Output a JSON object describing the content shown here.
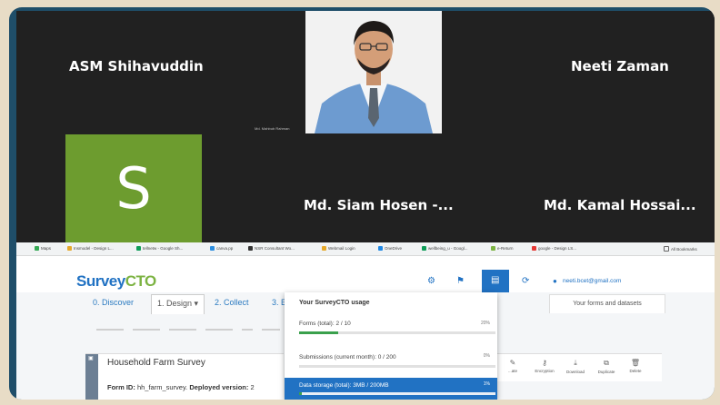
{
  "meeting": {
    "participants": [
      {
        "name": "ASM Shihavuddin"
      },
      {
        "name": "Neeti Zaman"
      },
      {
        "name": "Md. Siam Hosen -..."
      },
      {
        "name": "Md. Kamal Hossai..."
      }
    ],
    "host_caption": "Md. Mahbub Rahman",
    "avatar_letter": "S",
    "avatar_color": "#6d9c2f"
  },
  "browser": {
    "bookmarks": [
      "Maps",
      "Insmodel - Design L...",
      "tellnetw - Google Sh...",
      "canva.pp",
      "NSR Consultant Wo...",
      "Webmail Login",
      "OneDrive",
      "wellbeing_u - Googl...",
      "e-Return",
      "google - Design LS..."
    ],
    "all_bookmarks": "All Bookmarks"
  },
  "surveycto": {
    "logo_survey": "Survey",
    "logo_cto": "CTO",
    "user_email": "neeti.bcet@gmail.com",
    "your_forms": "Your forms and datasets",
    "nav": [
      "0. Discover",
      "1. Design",
      "2. Collect",
      "3. E"
    ],
    "usage": {
      "title": "Your SurveyCTO usage",
      "forms_label": "Forms (total): 2 / 10",
      "forms_pct": "20%",
      "forms_fraction": 0.2,
      "submissions_label": "Submissions (current month): 0 / 200",
      "submissions_pct": "0%",
      "submissions_fraction": 0.0,
      "storage_label": "Data storage (total): 3MB / 200MB",
      "storage_pct": "1%",
      "storage_fraction": 0.015
    },
    "survey": {
      "title": "Household Farm Survey",
      "form_id_label": "Form ID:",
      "form_id_value": "hh_farm_survey.",
      "deployed_label": "Deployed version:",
      "deployed_value": "2"
    },
    "actions": [
      "...ate",
      "Encryption",
      "Download",
      "Duplicate",
      "Delete"
    ],
    "colors": {
      "primary": "#2172c3",
      "success": "#3aa04c",
      "cto_green": "#7cb342"
    }
  }
}
